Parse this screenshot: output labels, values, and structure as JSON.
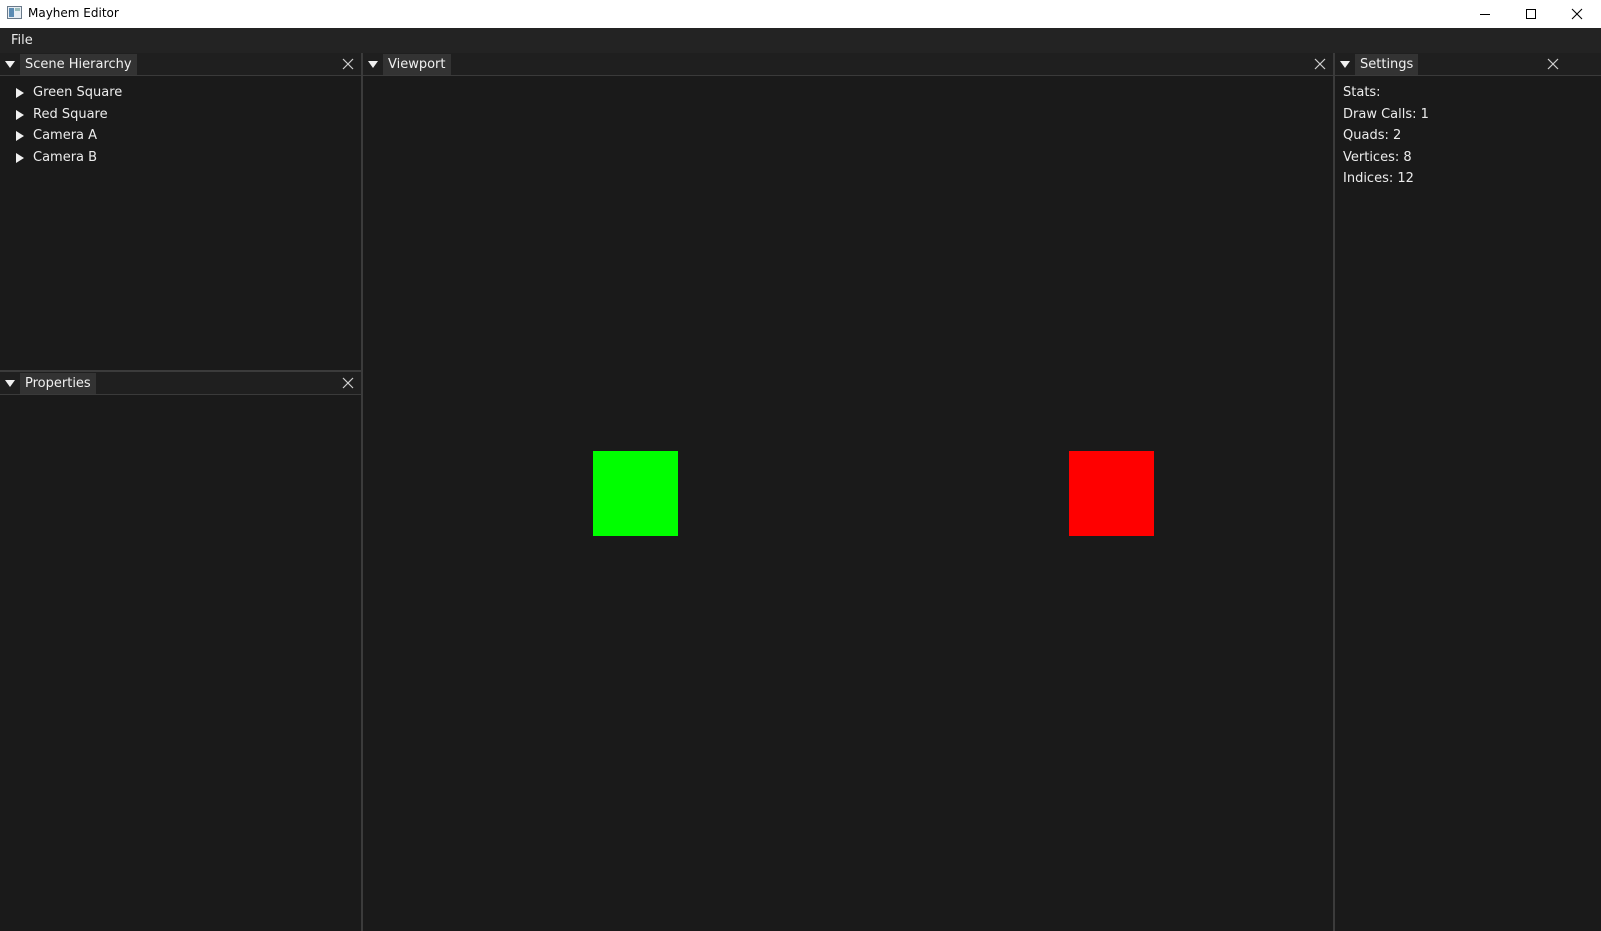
{
  "window": {
    "title": "Mayhem Editor"
  },
  "menu": {
    "items": [
      "File"
    ]
  },
  "scene_hierarchy": {
    "title": "Scene Hierarchy",
    "items": [
      {
        "label": "Green Square"
      },
      {
        "label": "Red Square"
      },
      {
        "label": "Camera A"
      },
      {
        "label": "Camera B"
      }
    ]
  },
  "properties": {
    "title": "Properties"
  },
  "viewport": {
    "title": "Viewport",
    "entities": [
      {
        "name": "Green Square",
        "color": "#00ff00"
      },
      {
        "name": "Red Square",
        "color": "#ff0000"
      }
    ]
  },
  "settings": {
    "title": "Settings",
    "stats_heading": "Stats:",
    "stats": [
      "Draw Calls: 1",
      "Quads: 2",
      "Vertices: 8",
      "Indices: 12"
    ]
  },
  "colors": {
    "background": "#1a1a1a",
    "tab": "#333333",
    "menubar": "#232323",
    "divider": "#3b3b3b"
  }
}
